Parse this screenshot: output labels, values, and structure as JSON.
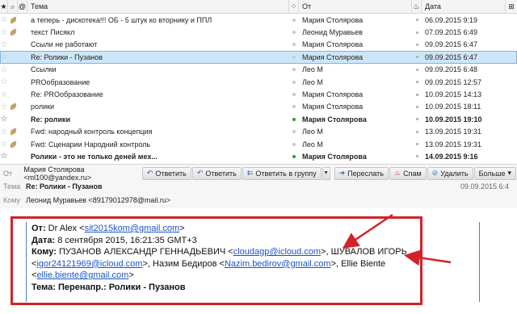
{
  "list": {
    "columns": {
      "subject": "Тема",
      "from": "От",
      "date": "Дата"
    },
    "rows": [
      {
        "subject": "а теперь - дискотека!!! ОБ - 5 штук ко вторнику и ППЛ",
        "from": "Мария Столярова",
        "date": "06.09.2015 9:19",
        "attach": true,
        "selected": false,
        "bold": false,
        "unread": false
      },
      {
        "subject": "текст Писякл",
        "from": "Леонид Муравьев",
        "date": "07.09.2015 6:49",
        "attach": true,
        "selected": false,
        "bold": false,
        "unread": false
      },
      {
        "subject": "Ссыли не работают",
        "from": "Мария Столярова",
        "date": "09.09.2015 6:47",
        "attach": false,
        "selected": false,
        "bold": false,
        "unread": false
      },
      {
        "subject": "Re: Ролики - Пузанов",
        "from": "Мария Столярова",
        "date": "09.09.2015 6:47",
        "attach": false,
        "selected": true,
        "bold": false,
        "unread": false
      },
      {
        "subject": "Ссылки",
        "from": "Лео М",
        "date": "09.09.2015 6:48",
        "attach": false,
        "selected": false,
        "bold": false,
        "unread": false
      },
      {
        "subject": "PROобразование",
        "from": "Лео М",
        "date": "09.09.2015 12:57",
        "attach": false,
        "selected": false,
        "bold": false,
        "unread": false
      },
      {
        "subject": "Re: PROобразование",
        "from": "Мария Столярова",
        "date": "10.09.2015 14:13",
        "attach": false,
        "selected": false,
        "bold": false,
        "unread": false
      },
      {
        "subject": "ролики",
        "from": "Мария Столярова",
        "date": "10.09.2015 18:11",
        "attach": true,
        "selected": false,
        "bold": false,
        "unread": false
      },
      {
        "subject": "Re: ролики",
        "from": "Мария Столярова",
        "date": "10.09.2015 19:10",
        "attach": false,
        "selected": false,
        "bold": true,
        "unread": true
      },
      {
        "subject": "Fwd: народный контроль концепция",
        "from": "Лео М",
        "date": "13.09.2015 19:31",
        "attach": true,
        "selected": false,
        "bold": false,
        "unread": false
      },
      {
        "subject": "Fwd: Сценарии Народний контроль",
        "from": "Лео М",
        "date": "13.09.2015 19:31",
        "attach": true,
        "selected": false,
        "bold": false,
        "unread": false
      },
      {
        "subject": "Ролики - это не только деней мех...",
        "from": "Мария Столярова",
        "date": "14.09.2015 9:16",
        "attach": false,
        "selected": false,
        "bold": true,
        "unread": true
      }
    ]
  },
  "header": {
    "from_label": "От",
    "from_value": "Мария Столярова <ml100@yandex.ru>",
    "subject_label": "Тема",
    "subject_value": "Re: Ролики - Пузанов",
    "to_label": "Кому",
    "to_value": "Леонид Муравьев <89179012978@mail.ru>",
    "date": "09.09.2015 6:4",
    "buttons": {
      "reply": "Ответить",
      "reply2": "Ответить",
      "reply_all": "Ответить в группу",
      "forward": "Переслать",
      "spam": "Спам",
      "delete": "Удалить",
      "more": "Больше"
    }
  },
  "forwarded": {
    "from_label": "От:",
    "from_name": "Dr Alex <",
    "from_email": "sit2015kom@gmail.com",
    "from_end": ">",
    "date_label": "Дата:",
    "date_value": "8 сентября 2015, 16:21:35 GMT+3",
    "to_label": "Кому:",
    "to_name1": "ПУЗАНОВ АЛЕКСАНДР ГЕННАДЬЕВИЧ <",
    "to_email1": "cloudagp@icloud.com",
    "to_name2": ">, ШУВАЛОВ ИГОРЬ <",
    "to_email2": "igor24121969@icloud.com",
    "to_name3": ">, Назим Бедиров <",
    "to_email3": "Nazim.bedirov@gmail.com",
    "to_name4": ">, Ellie Biente <",
    "to_email4": "ellie.biente@gmail.com",
    "to_end": ">",
    "subject_label": "Тема:",
    "subject_value": "Перенапр.: Ролики - Пузанов"
  },
  "colors": {
    "annotation_red": "#d2222a",
    "link": "#1a55c5",
    "selected_row": "#cde6f7"
  }
}
